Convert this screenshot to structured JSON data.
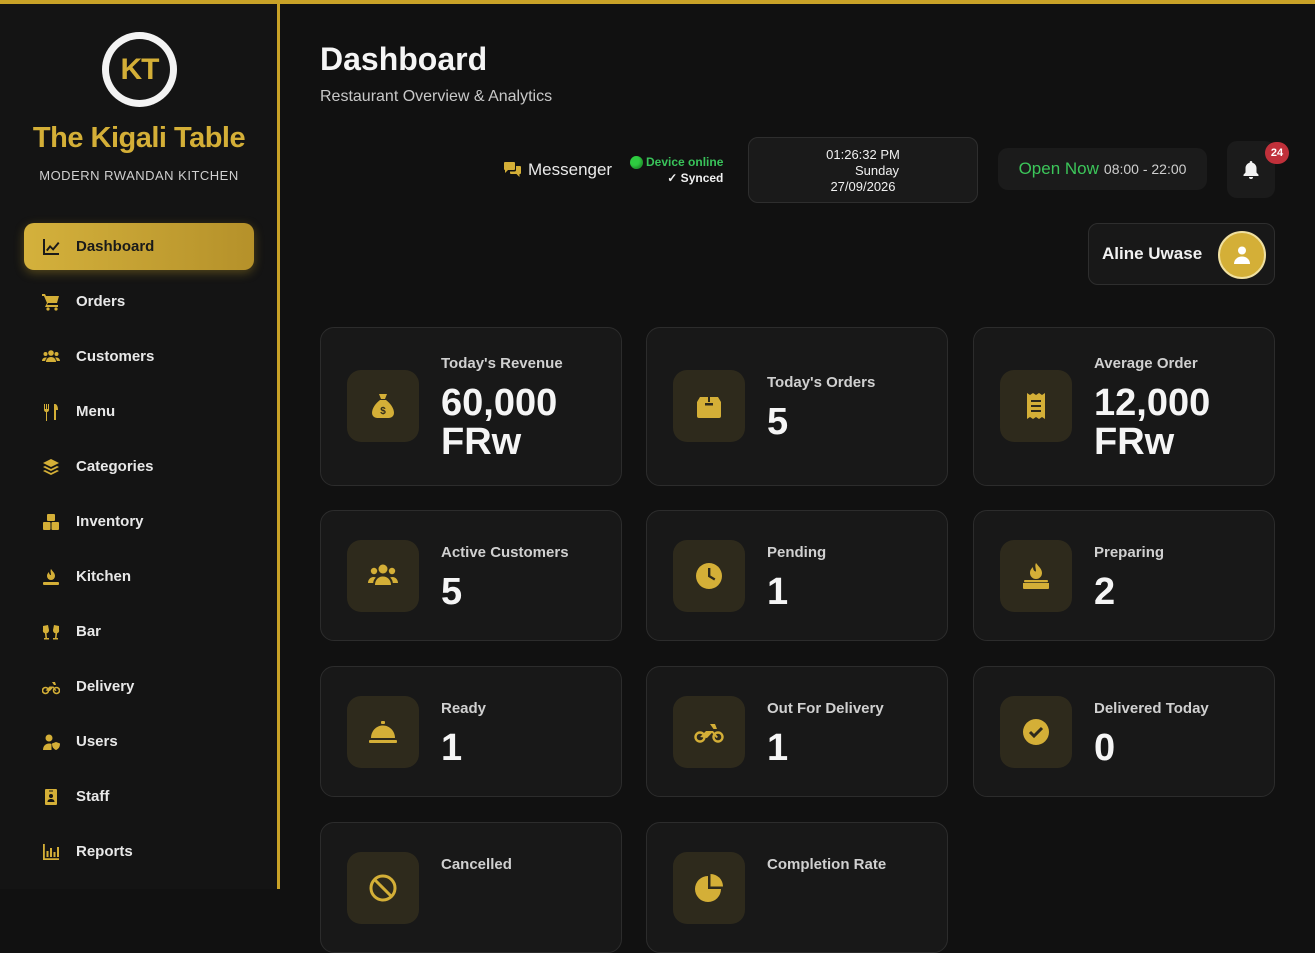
{
  "brand": {
    "logo_text": "KT",
    "name": "The Kigali Table",
    "tagline": "MODERN RWANDAN KITCHEN"
  },
  "sidebar": {
    "items": [
      {
        "label": "Dashboard",
        "icon": "chart-line-icon"
      },
      {
        "label": "Orders",
        "icon": "cart-icon"
      },
      {
        "label": "Customers",
        "icon": "users-icon"
      },
      {
        "label": "Menu",
        "icon": "utensils-icon"
      },
      {
        "label": "Categories",
        "icon": "layers-icon"
      },
      {
        "label": "Inventory",
        "icon": "boxes-icon"
      },
      {
        "label": "Kitchen",
        "icon": "burner-icon"
      },
      {
        "label": "Bar",
        "icon": "glasses-cheers-icon"
      },
      {
        "label": "Delivery",
        "icon": "motorcycle-icon"
      },
      {
        "label": "Users",
        "icon": "user-shield-icon"
      },
      {
        "label": "Staff",
        "icon": "id-badge-icon"
      },
      {
        "label": "Reports",
        "icon": "bar-chart-icon"
      }
    ]
  },
  "header": {
    "title": "Dashboard",
    "subtitle": "Restaurant Overview & Analytics",
    "messenger_label": "Messenger",
    "device_status": "Device online",
    "sync_status": "✓ Synced",
    "time": "01:26:32 PM",
    "day": "Sunday",
    "date": "27/09/2026",
    "open_status": "Open Now",
    "open_hours": "08:00 - 22:00",
    "notification_count": "24",
    "user_name": "Aline Uwase"
  },
  "stats": {
    "revenue": {
      "label": "Today's Revenue",
      "value": "60,000 FRw",
      "icon": "money-bag-icon"
    },
    "orders": {
      "label": "Today's Orders",
      "value": "5",
      "icon": "box-icon"
    },
    "average": {
      "label": "Average Order",
      "value": "12,000 FRw",
      "icon": "receipt-icon"
    },
    "active_customers": {
      "label": "Active Customers",
      "value": "5",
      "icon": "users-icon"
    },
    "pending": {
      "label": "Pending",
      "value": "1",
      "icon": "clock-icon"
    },
    "preparing": {
      "label": "Preparing",
      "value": "2",
      "icon": "burner-icon"
    },
    "ready": {
      "label": "Ready",
      "value": "1",
      "icon": "cloche-icon"
    },
    "out_for_delivery": {
      "label": "Out For Delivery",
      "value": "1",
      "icon": "motorcycle-icon"
    },
    "delivered": {
      "label": "Delivered Today",
      "value": "0",
      "icon": "check-circle-icon"
    },
    "cancelled": {
      "label": "Cancelled",
      "icon": "ban-icon"
    },
    "completion": {
      "label": "Completion Rate",
      "icon": "pie-chart-icon"
    }
  },
  "colors": {
    "accent": "#d4af37",
    "background": "#111111",
    "online": "#39c35a",
    "badge": "#c0303a"
  }
}
